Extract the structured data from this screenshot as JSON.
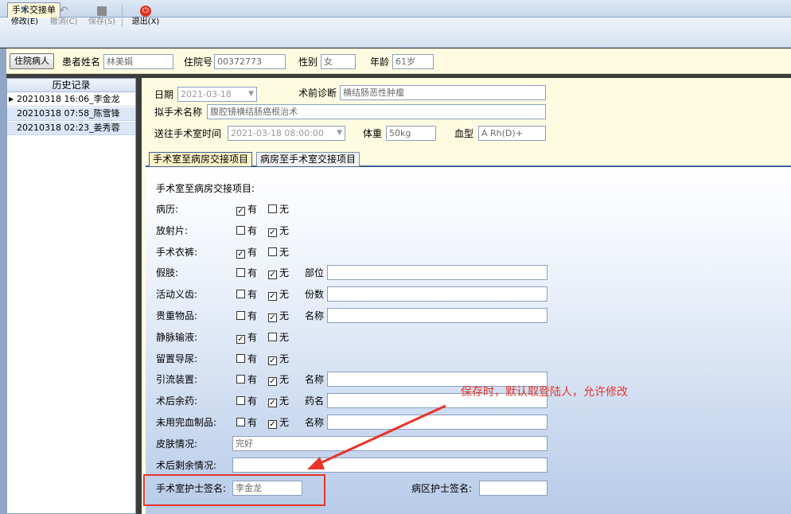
{
  "window": {
    "tab_title": "手术交接单"
  },
  "toolbar": {
    "modify": "修改(E)",
    "cancel": "撤消(C)",
    "save": "保存(S)",
    "exit": "退出(X)"
  },
  "patient": {
    "inpatient_button": "住院病人",
    "name_label": "患者姓名",
    "name_value": "林美娟",
    "admission_no_label": "住院号",
    "admission_no_value": "00372773",
    "gender_label": "性别",
    "gender_value": "女",
    "age_label": "年龄",
    "age_value": "61岁"
  },
  "history": {
    "header": "历史记录",
    "items": [
      "20210318 16:06_李金龙",
      "20210318 07:58_陈雪锋",
      "20210318 02:23_姜秀蓉"
    ]
  },
  "surgery": {
    "date_label": "日期",
    "date_value": "2021-03-18",
    "diagnosis_label": "术前诊断",
    "diagnosis_value": "横结肠恶性肿瘤",
    "planned_name_label": "拟手术名称",
    "planned_name_value": "腹腔镜横结肠癌根治术",
    "send_time_label": "送往手术室时间",
    "send_time_value": "2021-03-18 08:00:00",
    "weight_label": "体重",
    "weight_value": "50kg",
    "blood_label": "血型",
    "blood_value": "A Rh(D)+"
  },
  "tabs": [
    "手术室至病房交接项目",
    "病房至手术室交接项目"
  ],
  "form": {
    "section_title": "手术室至病房交接项目:",
    "yes_label": "有",
    "no_label": "无",
    "items": [
      {
        "label": "病历:",
        "yes": true,
        "no": false
      },
      {
        "label": "放射片:",
        "yes": false,
        "no": true
      },
      {
        "label": "手术衣裤:",
        "yes": true,
        "no": false
      },
      {
        "label": "假肢:",
        "yes": false,
        "no": true,
        "extra_label": "部位"
      },
      {
        "label": "活动义齿:",
        "yes": false,
        "no": true,
        "extra_label": "份数"
      },
      {
        "label": "贵重物品:",
        "yes": false,
        "no": true,
        "extra_label": "名称"
      },
      {
        "label": "静脉输液:",
        "yes": true,
        "no": false
      },
      {
        "label": "留置导尿:",
        "yes": false,
        "no": true
      },
      {
        "label": "引流装置:",
        "yes": false,
        "no": true,
        "extra_label": "名称"
      },
      {
        "label": "术后余药:",
        "yes": false,
        "no": true,
        "extra_label": "药名"
      },
      {
        "label": "未用完血制品:",
        "yes": false,
        "no": true,
        "extra_label": "名称"
      }
    ],
    "skin_label": "皮肤情况:",
    "skin_value": "完好",
    "remaining_label": "术后剩余情况:",
    "remaining_value": "",
    "or_nurse_label": "手术室护士签名:",
    "or_nurse_value": "李金龙",
    "ward_nurse_label": "病区护士签名:",
    "ward_nurse_value": ""
  },
  "annotation": {
    "text": "保存时，默认取登陆人，允许修改",
    "color": "#e8342a"
  }
}
